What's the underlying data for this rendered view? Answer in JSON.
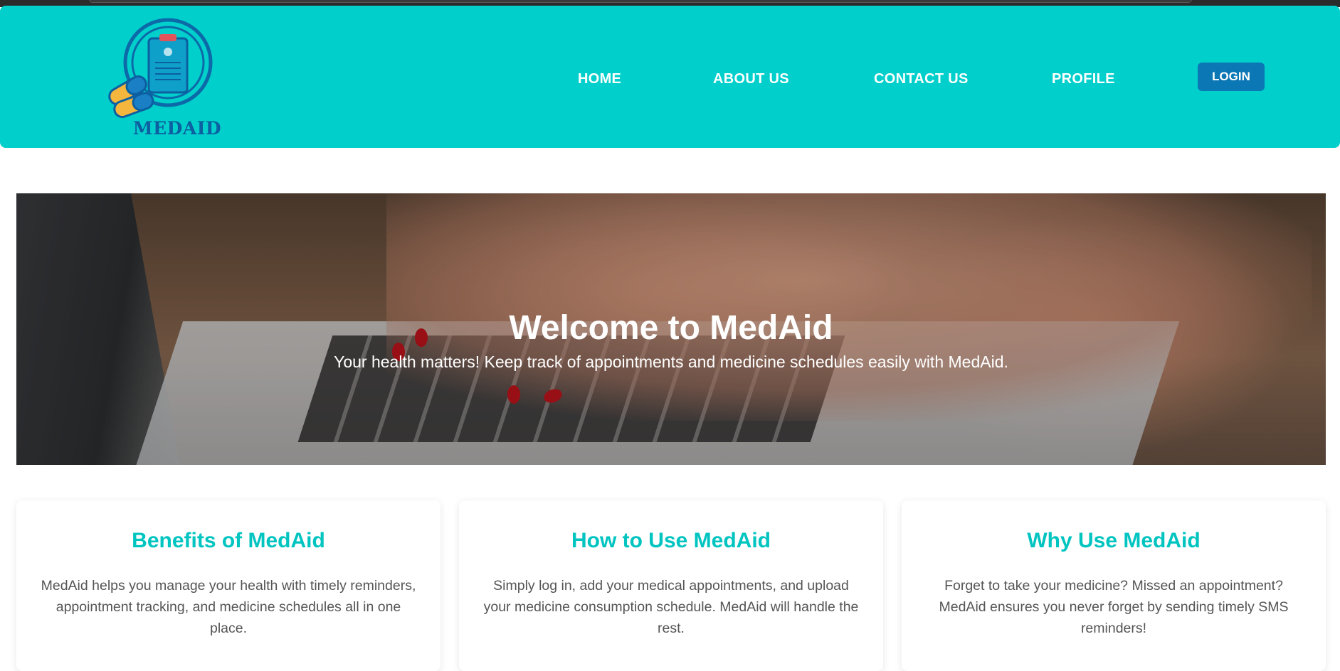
{
  "brand": {
    "name": "MEDAID"
  },
  "nav": {
    "items": [
      {
        "label": "HOME"
      },
      {
        "label": "ABOUT US"
      },
      {
        "label": "CONTACT US"
      },
      {
        "label": "PROFILE"
      }
    ],
    "login_label": "LOGIN"
  },
  "hero": {
    "title": "Welcome to MedAid",
    "subtitle": "Your health matters! Keep track of appointments and medicine schedules easily with MedAid."
  },
  "cards": [
    {
      "title": "Benefits of MedAid",
      "text": "MedAid helps you manage your health with timely reminders, appointment tracking, and medicine schedules all in one place."
    },
    {
      "title": "How to Use MedAid",
      "text": "Simply log in, add your medical appointments, and upload your medicine consumption schedule. MedAid will handle the rest."
    },
    {
      "title": "Why Use MedAid",
      "text": "Forget to take your medicine? Missed an appointment? MedAid ensures you never forget by sending timely SMS reminders!"
    }
  ],
  "colors": {
    "header_bg": "#00cfcb",
    "accent": "#00c4c0",
    "login_bg": "#0c77b5",
    "logo_blue": "#0c5fa0"
  }
}
